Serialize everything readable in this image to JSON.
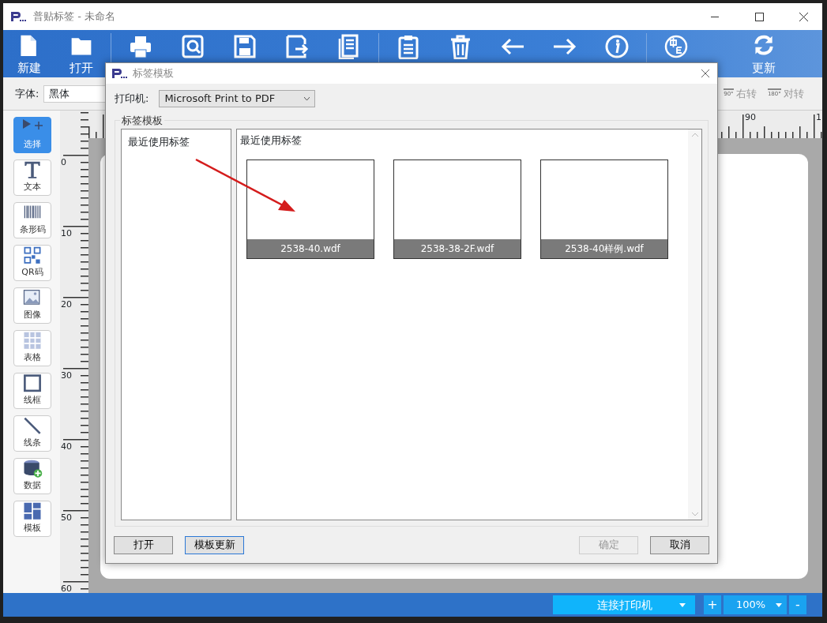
{
  "window": {
    "title": "普贴标签 - 未命名"
  },
  "toolbar": {
    "left_labels": [
      "新建",
      "打开"
    ],
    "right_label": "更新"
  },
  "font_bar": {
    "label": "字体:",
    "font": "黑体",
    "rotate_right": {
      "badge": "90°",
      "label": "右转"
    },
    "rotate_flip": {
      "badge": "180°",
      "label": "对转"
    }
  },
  "tools": [
    {
      "label": "选择",
      "selected": true
    },
    {
      "label": "文本",
      "selected": false
    },
    {
      "label": "条形码",
      "selected": false
    },
    {
      "label": "QR码",
      "selected": false
    },
    {
      "label": "图像",
      "selected": false
    },
    {
      "label": "表格",
      "selected": false
    },
    {
      "label": "线框",
      "selected": false
    },
    {
      "label": "线条",
      "selected": false
    },
    {
      "label": "数据",
      "selected": false
    },
    {
      "label": "模板",
      "selected": false
    }
  ],
  "ruler": {
    "top_labels": [
      "90",
      "1"
    ],
    "left_labels": [
      "0",
      "10",
      "20",
      "30",
      "40",
      "50",
      "60"
    ]
  },
  "dialog": {
    "title": "标签模板",
    "printer_label": "打印机:",
    "printer": "Microsoft Print to PDF",
    "group_title": "标签模板",
    "categories": [
      {
        "label": "最近使用标签",
        "selected": false
      }
    ],
    "panel_title": "最近使用标签",
    "templates": [
      {
        "name": "2538-40.wdf"
      },
      {
        "name": "2538-38-2F.wdf"
      },
      {
        "name": "2538-40样例.wdf"
      }
    ],
    "buttons_left": [
      {
        "label": "打开",
        "disabled": false
      },
      {
        "label": "模板更新",
        "disabled": false
      }
    ],
    "buttons_right": [
      {
        "label": "确定",
        "disabled": true
      },
      {
        "label": "取消",
        "disabled": false
      }
    ]
  },
  "status_bar": {
    "printer": "连接打印机",
    "zoom_in": "+",
    "zoom": "100%",
    "zoom_out": "-"
  }
}
